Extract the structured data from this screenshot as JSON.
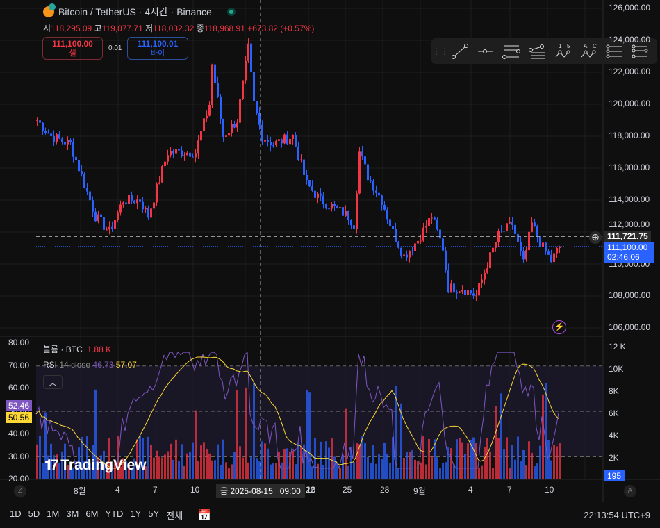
{
  "header": {
    "title": "Bitcoin / TetherUS · 4시간 · Binance"
  },
  "ohlc": {
    "o_label": "시",
    "o": "118,295.09",
    "h_label": "고",
    "h": "119,077.71",
    "l_label": "저",
    "l": "118,032.32",
    "c_label": "종",
    "c": "118,968.91",
    "change": "+673.82 (+0.57%)"
  },
  "trade": {
    "sell_price": "111,100.00",
    "sell_label": "셀",
    "spread": "0.01",
    "buy_price": "111,100.01",
    "buy_label": "바이"
  },
  "drawing_tools": [
    "trend-line",
    "horizontal-ray",
    "parallel-channel",
    "pitchfork",
    "abcd-1-5",
    "abc-pattern",
    "fib-retracement",
    "fib-extension"
  ],
  "price_axis": {
    "ticks": [
      "126,000.00",
      "124,000.00",
      "122,000.00",
      "120,000.00",
      "118,000.00",
      "116,000.00",
      "114,000.00",
      "112,000.00",
      "110,000.00",
      "108,000.00",
      "106,000.00"
    ],
    "crosshair_price": "111,721.75",
    "last_price": "111,100.00",
    "countdown": "02:46:06"
  },
  "volume": {
    "label": "볼륨 · BTC",
    "value": "1.88 K",
    "axis": [
      "12 K",
      "10K",
      "8K",
      "6K",
      "4K",
      "2K"
    ],
    "last": "195"
  },
  "rsi": {
    "label": "RSI",
    "params": "14 close",
    "value": "46.73",
    "ma": "57.07",
    "axis": [
      "80.00",
      "70.00",
      "60.00",
      "50.00",
      "40.00",
      "30.00",
      "20.00"
    ],
    "badge_rsi": "52.46",
    "badge_ma": "50.56"
  },
  "time_axis": {
    "ticks": [
      "8월",
      "4",
      "7",
      "10",
      "19",
      "22",
      "25",
      "28",
      "9월",
      "4",
      "7",
      "10"
    ],
    "crosshair": "금 2025-08-15   09:00"
  },
  "ranges": [
    "1D",
    "5D",
    "1M",
    "3M",
    "6M",
    "YTD",
    "1Y",
    "5Y",
    "전체"
  ],
  "clock": "22:13:54 UTC+9",
  "watermark": "TradingView",
  "colors": {
    "up": "#f23645",
    "down": "#2962ff",
    "rsi": "#7e57c2",
    "rsi_ma": "#fdd835"
  },
  "chart_data": {
    "type": "candlestick",
    "interval": "4h",
    "price_range": [
      106000,
      126000
    ],
    "close_path": [
      [
        0,
        119000
      ],
      [
        5,
        118000
      ],
      [
        12,
        117500
      ],
      [
        17,
        115000
      ],
      [
        21,
        113000
      ],
      [
        26,
        112000
      ],
      [
        31,
        114000
      ],
      [
        37,
        114000
      ],
      [
        40,
        113000
      ],
      [
        47,
        117000
      ],
      [
        57,
        117000
      ],
      [
        62,
        120000
      ],
      [
        63,
        122500
      ],
      [
        67,
        118000
      ],
      [
        72,
        119000
      ],
      [
        76,
        123500
      ],
      [
        78,
        120000
      ],
      [
        81,
        118000
      ],
      [
        85,
        117500
      ],
      [
        92,
        118000
      ],
      [
        97,
        115000
      ],
      [
        102,
        114000
      ],
      [
        107,
        113500
      ],
      [
        112,
        113000
      ],
      [
        114,
        112500
      ],
      [
        116,
        117000
      ],
      [
        119,
        115500
      ],
      [
        124,
        114000
      ],
      [
        128,
        112000
      ],
      [
        132,
        110500
      ],
      [
        137,
        111500
      ],
      [
        142,
        113000
      ],
      [
        146,
        111000
      ],
      [
        148,
        108500
      ],
      [
        153,
        108500
      ],
      [
        158,
        108000
      ],
      [
        162,
        110000
      ],
      [
        166,
        111800
      ],
      [
        171,
        112500
      ],
      [
        175,
        110000
      ],
      [
        178,
        112500
      ],
      [
        182,
        111000
      ],
      [
        185,
        110200
      ],
      [
        188,
        111100
      ]
    ]
  }
}
